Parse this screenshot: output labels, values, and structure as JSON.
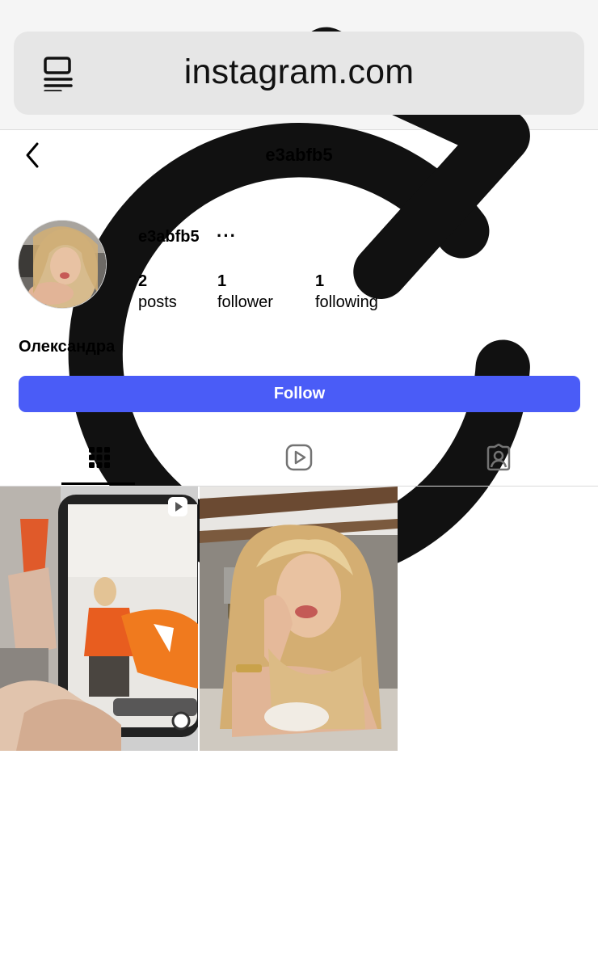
{
  "browser": {
    "url": "instagram.com",
    "reader_icon": "reader-mode-icon",
    "reload_icon": "reload-icon"
  },
  "nav": {
    "title": "e3abfb5",
    "back_icon": "chevron-left-icon"
  },
  "profile": {
    "username": "e3abfb5",
    "more": "···",
    "full_name": "Олександра",
    "stats": [
      {
        "value": "2",
        "label": "posts"
      },
      {
        "value": "1",
        "label": "follower"
      },
      {
        "value": "1",
        "label": "following"
      }
    ],
    "follow_label": "Follow"
  },
  "tabs": [
    {
      "name": "posts",
      "icon": "grid-icon",
      "active": true
    },
    {
      "name": "reels",
      "icon": "reels-play-icon",
      "active": false
    },
    {
      "name": "tagged",
      "icon": "tagged-person-icon",
      "active": false
    }
  ],
  "posts": [
    {
      "type": "reel",
      "badge_icon": "reel-badge-icon"
    },
    {
      "type": "photo"
    }
  ],
  "colors": {
    "follow_button": "#4a5cf7",
    "chrome_bg": "#f5f5f5",
    "url_bar_bg": "#e6e6e6"
  }
}
